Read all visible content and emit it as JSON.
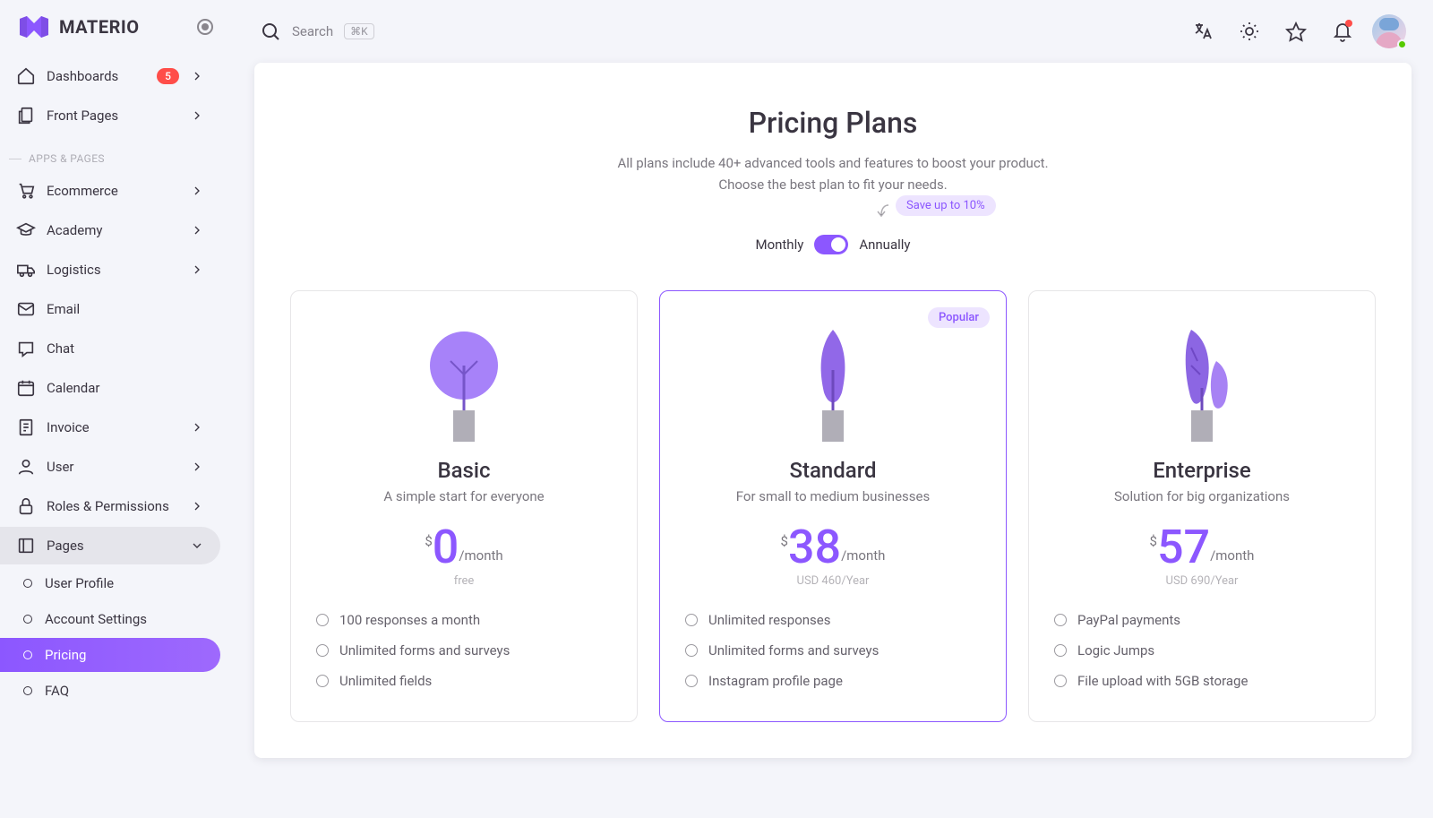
{
  "brand": "MATERIO",
  "topbar": {
    "search_placeholder": "Search",
    "shortcut": "⌘K"
  },
  "sidebar": {
    "top": [
      {
        "label": "Dashboards",
        "icon": "home",
        "badge": "5",
        "chev": true
      },
      {
        "label": "Front Pages",
        "icon": "files",
        "chev": true
      }
    ],
    "section_label": "APPS & PAGES",
    "items": [
      {
        "label": "Ecommerce",
        "icon": "cart",
        "chev": true
      },
      {
        "label": "Academy",
        "icon": "grad",
        "chev": true
      },
      {
        "label": "Logistics",
        "icon": "truck",
        "chev": true
      },
      {
        "label": "Email",
        "icon": "mail"
      },
      {
        "label": "Chat",
        "icon": "chat"
      },
      {
        "label": "Calendar",
        "icon": "calendar"
      },
      {
        "label": "Invoice",
        "icon": "invoice",
        "chev": true
      },
      {
        "label": "User",
        "icon": "user",
        "chev": true
      },
      {
        "label": "Roles & Permissions",
        "icon": "lock",
        "chev": true
      },
      {
        "label": "Pages",
        "icon": "pages",
        "chev": true,
        "open": true
      }
    ],
    "sub": [
      {
        "label": "User Profile"
      },
      {
        "label": "Account Settings"
      },
      {
        "label": "Pricing",
        "active": true
      },
      {
        "label": "FAQ"
      }
    ]
  },
  "page": {
    "title": "Pricing Plans",
    "sub1": "All plans include 40+ advanced tools and features to boost your product.",
    "sub2": "Choose the best plan to fit your needs.",
    "save_chip": "Save up to 10%",
    "toggle_left": "Monthly",
    "toggle_right": "Annually"
  },
  "plans": [
    {
      "name": "Basic",
      "tag": "A simple start for everyone",
      "price": "0",
      "yearly": "free",
      "features": [
        "100 responses a month",
        "Unlimited forms and surveys",
        "Unlimited fields"
      ]
    },
    {
      "name": "Standard",
      "tag": "For small to medium businesses",
      "price": "38",
      "yearly": "USD 460/Year",
      "popular": "Popular",
      "features": [
        "Unlimited responses",
        "Unlimited forms and surveys",
        "Instagram profile page"
      ]
    },
    {
      "name": "Enterprise",
      "tag": "Solution for big organizations",
      "price": "57",
      "yearly": "USD 690/Year",
      "features": [
        "PayPal payments",
        "Logic Jumps",
        "File upload with 5GB storage"
      ]
    }
  ],
  "currency": "$",
  "per_label": "/month"
}
